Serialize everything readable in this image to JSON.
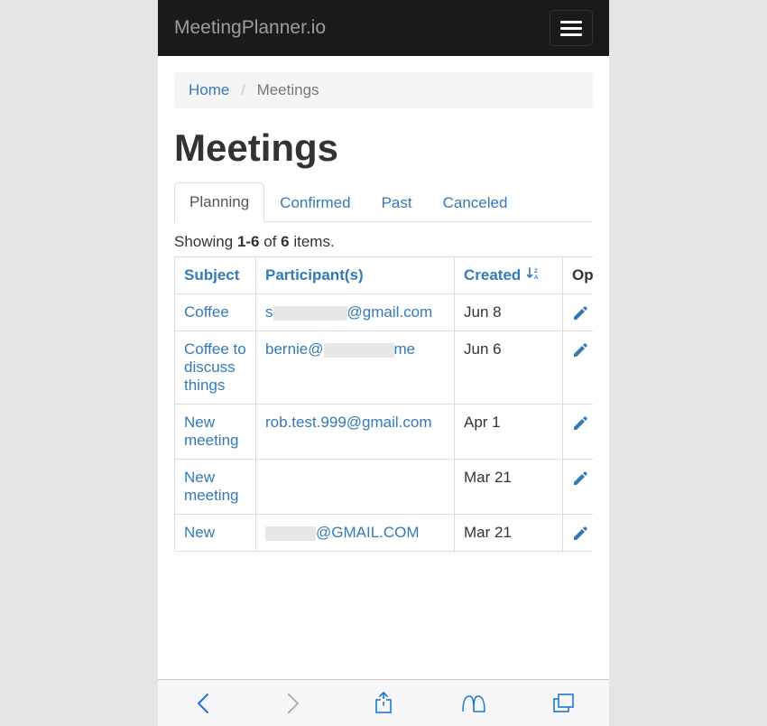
{
  "brand": "MeetingPlanner.io",
  "breadcrumb": {
    "home": "Home",
    "current": "Meetings"
  },
  "page_title": "Meetings",
  "tabs": [
    {
      "label": "Planning",
      "active": true
    },
    {
      "label": "Confirmed",
      "active": false
    },
    {
      "label": "Past",
      "active": false
    },
    {
      "label": "Canceled",
      "active": false
    }
  ],
  "summary": {
    "prefix": "Showing ",
    "range": "1-6",
    "mid": " of ",
    "total": "6",
    "suffix": " items."
  },
  "columns": {
    "subject": "Subject",
    "participants": "Participant(s)",
    "created": "Created",
    "options": "Options"
  },
  "rows": [
    {
      "subject": "Coffee",
      "participant_prefix": "s",
      "participant_redact_w": 82,
      "participant_suffix": "@gmail.com",
      "created": "Jun 8"
    },
    {
      "subject": "Coffee to discuss things",
      "participant_prefix": "bernie@",
      "participant_redact_w": 78,
      "participant_suffix": "me",
      "created": "Jun 6"
    },
    {
      "subject": "New meeting",
      "participant_prefix": "rob.test.999@gmail.com",
      "participant_redact_w": 0,
      "participant_suffix": "",
      "created": "Apr 1"
    },
    {
      "subject": "New meeting",
      "participant_prefix": "",
      "participant_redact_w": 0,
      "participant_suffix": "",
      "created": "Mar 21"
    },
    {
      "subject": "New",
      "participant_prefix": "",
      "participant_redact_w": 56,
      "participant_suffix": "@GMAIL.COM",
      "created": "Mar 21"
    }
  ]
}
